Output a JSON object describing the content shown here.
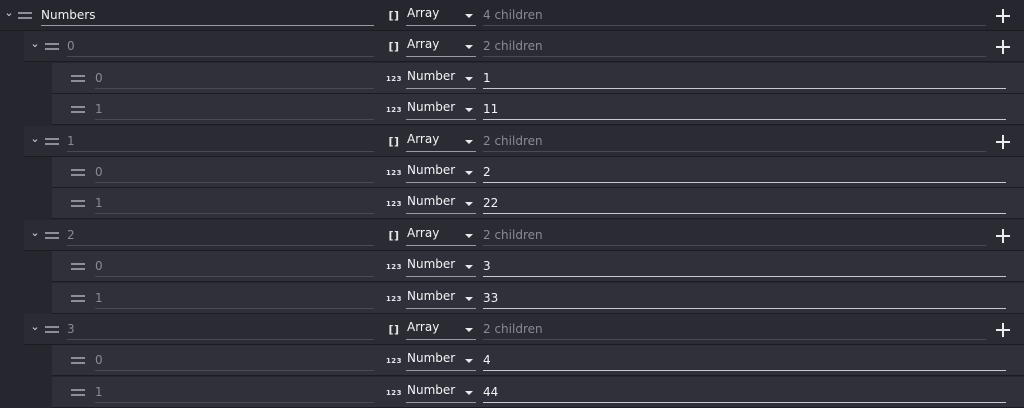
{
  "root": {
    "key": "Numbers",
    "type": "Array",
    "value_hint": "4 children",
    "type_icon": "[]"
  },
  "groups": [
    {
      "key": "0",
      "type": "Array",
      "value_hint": "2 children",
      "type_icon": "[]",
      "children": [
        {
          "key": "0",
          "type": "Number",
          "value": "1",
          "type_icon": "123"
        },
        {
          "key": "1",
          "type": "Number",
          "value": "11",
          "type_icon": "123"
        }
      ]
    },
    {
      "key": "1",
      "type": "Array",
      "value_hint": "2 children",
      "type_icon": "[]",
      "children": [
        {
          "key": "0",
          "type": "Number",
          "value": "2",
          "type_icon": "123"
        },
        {
          "key": "1",
          "type": "Number",
          "value": "22",
          "type_icon": "123"
        }
      ]
    },
    {
      "key": "2",
      "type": "Array",
      "value_hint": "2 children",
      "type_icon": "[]",
      "children": [
        {
          "key": "0",
          "type": "Number",
          "value": "3",
          "type_icon": "123"
        },
        {
          "key": "1",
          "type": "Number",
          "value": "33",
          "type_icon": "123"
        }
      ]
    },
    {
      "key": "3",
      "type": "Array",
      "value_hint": "2 children",
      "type_icon": "[]",
      "children": [
        {
          "key": "0",
          "type": "Number",
          "value": "4",
          "type_icon": "123"
        },
        {
          "key": "1",
          "type": "Number",
          "value": "44",
          "type_icon": "123"
        }
      ]
    }
  ],
  "icons": {
    "collapse": "chevron-down-icon",
    "drag": "drag-handle-icon",
    "add": "plus-icon",
    "dropdown": "caret-down-icon"
  },
  "colors": {
    "background": "#26262e",
    "group_row": "#2b2b34",
    "child_row": "#30303a"
  }
}
